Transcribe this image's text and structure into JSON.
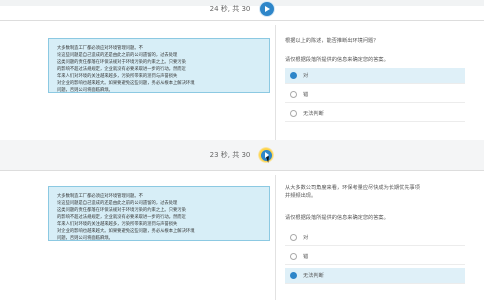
{
  "top": {
    "counter": "24 秒, 共 30"
  },
  "mid": {
    "counter": "23 秒, 共 30"
  },
  "q1": {
    "passage": [
      "大多数制造工厂都必须应对环境管理问题。不",
      "论这些问题是自己造成的还是由此之前的公司遗留的，过去处理",
      "这类问题的责任都落在环保法规对于环境污染的约束之上。只要污染",
      "的影响不超过法规规定，企业就没有必要采取进一步的行动。然而近",
      "年来人们对环境的关注越来越多，污染所带来的惩罚与声誉损失",
      "对企业的影响也越来越大。如果要避免这些问题，务必从根本上解决环境",
      "问题，否则公司将面临麻烦。"
    ],
    "question": "根据以上的陈述，能否推断出环境问题？",
    "prompt": "请仅根据段落所提供的信息来确定您的答案。",
    "options": [
      {
        "label": "对"
      },
      {
        "label": "错"
      },
      {
        "label": "无法判断"
      }
    ]
  },
  "q2": {
    "passage": [
      "大多数制造工厂都必须应对环境管理问题。不",
      "论这些问题是自己造成的还是由此之前的公司遗留的，过去处理",
      "这类问题的责任都落在环保法规对于环境污染的约束之上。只要污染",
      "的影响不超过法规规定，企业就没有必要采取进一步的行动。然而近",
      "年来人们对环境的关注越来越多，污染所带来的惩罚与声誉损失",
      "对企业的影响也越来越大。如果要避免这些问题，务必从根本上解决环境",
      "问题，否则公司将面临麻烦。"
    ],
    "question_lines": [
      "从大多数公司角度来看，环保考量应尽快成为长期优先事项",
      "并频频出现。"
    ],
    "prompt": "请仅根据段落所提供的信息来确定您的答案。",
    "options": [
      {
        "label": "对"
      },
      {
        "label": "错"
      },
      {
        "label": "无法判断"
      }
    ]
  },
  "colors": {
    "accent": "#2e86c9",
    "passage_bg": "#d7eef7",
    "selected_bg": "#dff0f8"
  }
}
